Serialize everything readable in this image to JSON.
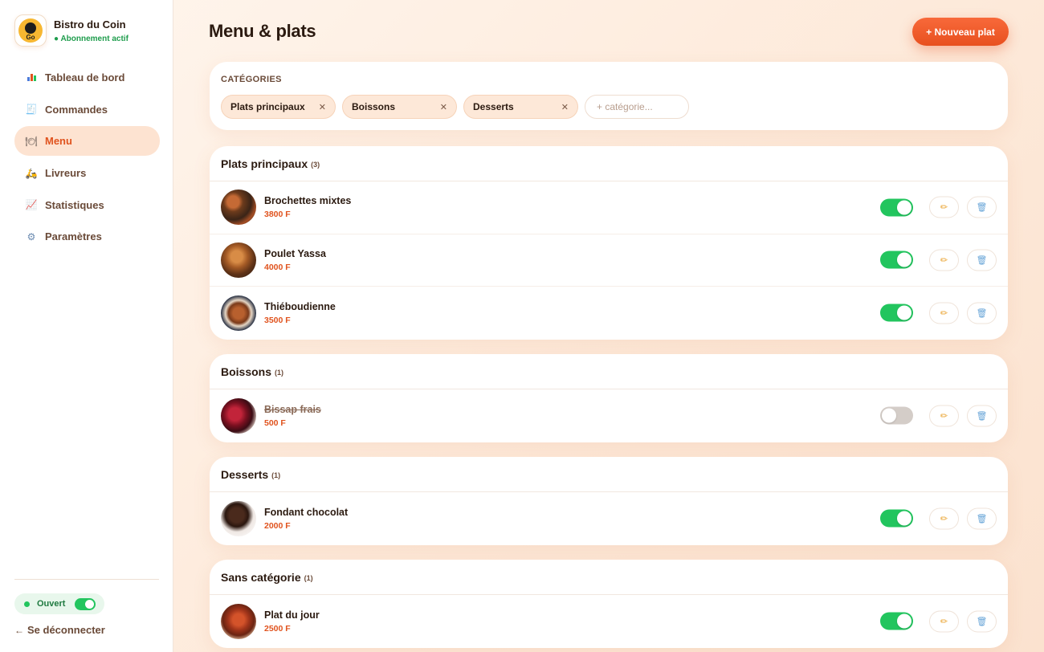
{
  "brand": {
    "name": "Bistro du Coin",
    "status": "● Abonnement actif",
    "logo_text": "Go"
  },
  "nav": [
    {
      "label": "Tableau de bord",
      "icon": "bar-chart-icon"
    },
    {
      "label": "Commandes",
      "icon": "receipt-icon"
    },
    {
      "label": "Menu",
      "icon": "fork-knife-icon",
      "active": true
    },
    {
      "label": "Livreurs",
      "icon": "scooter-icon"
    },
    {
      "label": "Statistiques",
      "icon": "trend-chart-icon"
    },
    {
      "label": "Paramètres",
      "icon": "gear-icon"
    }
  ],
  "open_status": {
    "label": "Ouvert",
    "on": true
  },
  "logout_label": "Se déconnecter",
  "page": {
    "title": "Menu & plats",
    "new_button": "+ Nouveau plat"
  },
  "categories": {
    "heading": "CATÉGORIES",
    "chips": [
      "Plats principaux",
      "Boissons",
      "Desserts"
    ],
    "input_placeholder": "+ catégorie..."
  },
  "sections": [
    {
      "title": "Plats principaux",
      "count": "(3)",
      "items": [
        {
          "name": "Brochettes mixtes",
          "price": "3800 F",
          "enabled": true
        },
        {
          "name": "Poulet Yassa",
          "price": "4000 F",
          "enabled": true
        },
        {
          "name": "Thiéboudienne",
          "price": "3500 F",
          "enabled": true
        }
      ]
    },
    {
      "title": "Boissons",
      "count": "(1)",
      "items": [
        {
          "name": "Bissap frais",
          "price": "500 F",
          "enabled": false
        }
      ]
    },
    {
      "title": "Desserts",
      "count": "(1)",
      "items": [
        {
          "name": "Fondant chocolat",
          "price": "2000 F",
          "enabled": true
        }
      ]
    },
    {
      "title": "Sans catégorie",
      "count": "(1)",
      "items": [
        {
          "name": "Plat du jour",
          "price": "2500 F",
          "enabled": true
        }
      ]
    }
  ],
  "colors": {
    "accent": "#e8501f",
    "active_nav_bg": "#fde3d1",
    "toggle_on": "#22c55e",
    "toggle_off": "#d4cdc8",
    "price": "#e0531e"
  }
}
